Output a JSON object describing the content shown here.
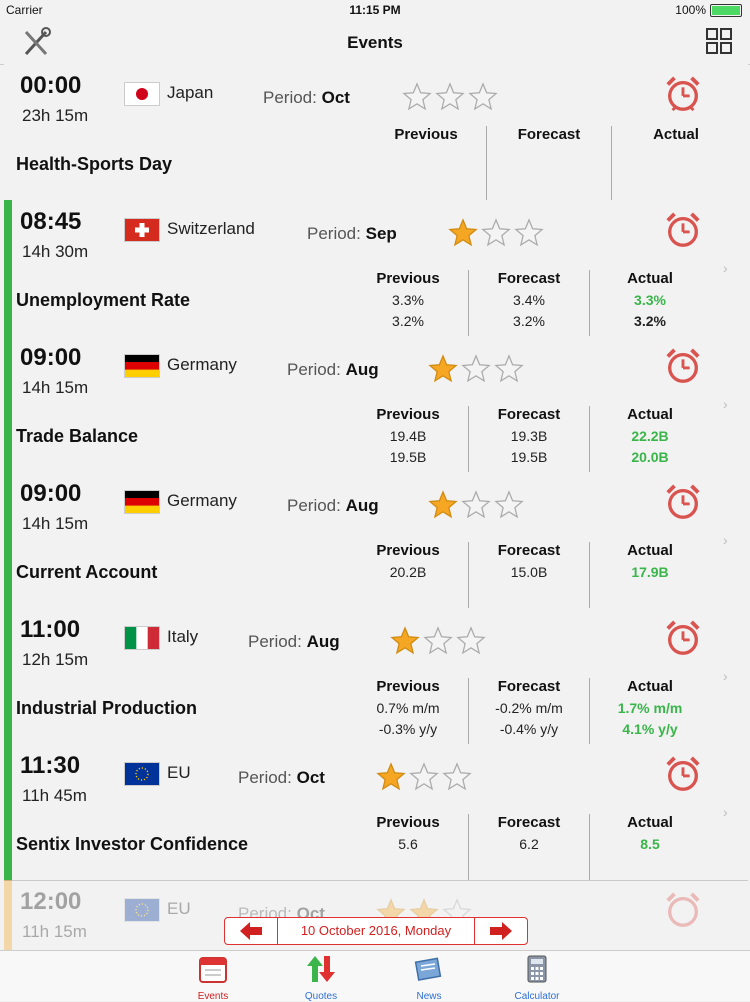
{
  "status": {
    "carrier": "Carrier",
    "time": "11:15 PM",
    "battery": "100%"
  },
  "nav": {
    "title": "Events"
  },
  "events": [
    {
      "time": "00:00",
      "countdown": "23h 15m",
      "country": "Japan",
      "period_label": "Period:",
      "period": "Oct",
      "stars_filled": 0,
      "name": "Health-Sports Day",
      "headers": [
        "Previous",
        "Forecast",
        "Actual"
      ],
      "previous": [],
      "forecast": [],
      "actual": []
    },
    {
      "time": "08:45",
      "countdown": "14h 30m",
      "country": "Switzerland",
      "period_label": "Period:",
      "period": "Sep",
      "stars_filled": 1,
      "name": "Unemployment Rate",
      "headers": [
        "Previous",
        "Forecast",
        "Actual"
      ],
      "previous": [
        "3.3%",
        "3.2%"
      ],
      "forecast": [
        "3.4%",
        "3.2%"
      ],
      "actual": [
        "3.3%",
        "3.2%"
      ]
    },
    {
      "time": "09:00",
      "countdown": "14h 15m",
      "country": "Germany",
      "period_label": "Period:",
      "period": "Aug",
      "stars_filled": 1,
      "name": "Trade Balance",
      "headers": [
        "Previous",
        "Forecast",
        "Actual"
      ],
      "previous": [
        "19.4B",
        "19.5B"
      ],
      "forecast": [
        "19.3B",
        "19.5B"
      ],
      "actual": [
        "22.2B",
        "20.0B"
      ]
    },
    {
      "time": "09:00",
      "countdown": "14h 15m",
      "country": "Germany",
      "period_label": "Period:",
      "period": "Aug",
      "stars_filled": 1,
      "name": "Current Account",
      "headers": [
        "Previous",
        "Forecast",
        "Actual"
      ],
      "previous": [
        "20.2B"
      ],
      "forecast": [
        "15.0B"
      ],
      "actual": [
        "17.9B"
      ]
    },
    {
      "time": "11:00",
      "countdown": "12h 15m",
      "country": "Italy",
      "period_label": "Period:",
      "period": "Aug",
      "stars_filled": 1,
      "name": "Industrial Production",
      "headers": [
        "Previous",
        "Forecast",
        "Actual"
      ],
      "previous": [
        "0.7% m/m",
        "-0.3% y/y"
      ],
      "forecast": [
        "-0.2% m/m",
        "-0.4% y/y"
      ],
      "actual": [
        "1.7% m/m",
        "4.1% y/y"
      ]
    },
    {
      "time": "11:30",
      "countdown": "11h 45m",
      "country": "EU",
      "period_label": "Period:",
      "period": "Oct",
      "stars_filled": 1,
      "name": "Sentix Investor Confidence",
      "headers": [
        "Previous",
        "Forecast",
        "Actual"
      ],
      "previous": [
        "5.6"
      ],
      "forecast": [
        "6.2"
      ],
      "actual": [
        "8.5"
      ]
    },
    {
      "time": "12:00",
      "countdown": "11h 15m",
      "country": "EU",
      "period_label": "Period:",
      "period": "Oct",
      "stars_filled": 2,
      "name": "",
      "headers": [],
      "previous": [],
      "forecast": [],
      "actual": []
    }
  ],
  "date_nav": {
    "date": "10 October 2016, Monday"
  },
  "tabs": [
    {
      "label": "Events",
      "icon": "calendar-icon"
    },
    {
      "label": "Quotes",
      "icon": "quotes-arrows-icon"
    },
    {
      "label": "News",
      "icon": "newspaper-icon"
    },
    {
      "label": "Calculator",
      "icon": "calculator-icon"
    }
  ],
  "colors": {
    "accent_red": "#d02020",
    "positive_green": "#39b54a",
    "bar_green": "#3bb54a",
    "bar_orange": "#f5a623",
    "star_gold": "#f5a623"
  }
}
